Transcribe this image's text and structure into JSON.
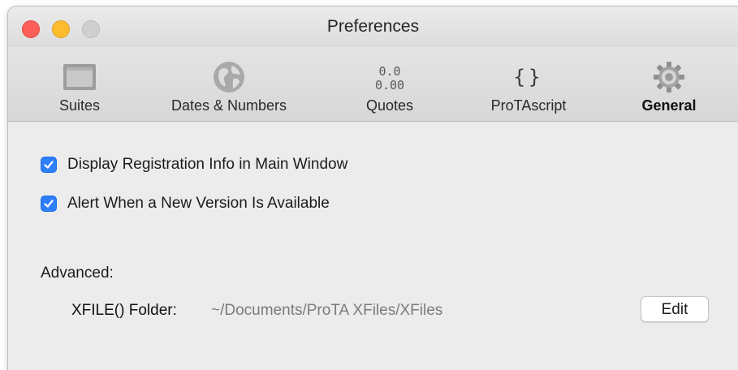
{
  "window": {
    "title": "Preferences"
  },
  "toolbar": {
    "items": [
      {
        "label": "Suites",
        "icon": "suites-icon"
      },
      {
        "label": "Dates & Numbers",
        "icon": "globe-icon"
      },
      {
        "label": "Quotes",
        "icon": "quotes-icon",
        "icon_text_1": "0.0",
        "icon_text_2": "0.00"
      },
      {
        "label": "ProTAscript",
        "icon": "braces-icon",
        "icon_text": "{}"
      },
      {
        "label": "General",
        "icon": "gear-icon",
        "selected": true
      }
    ]
  },
  "general": {
    "display_registration": {
      "label": "Display Registration Info in Main Window",
      "checked": true
    },
    "alert_new_version": {
      "label": "Alert When a New Version Is Available",
      "checked": true
    },
    "advanced_label": "Advanced:",
    "xfile_folder_label": "XFILE() Folder:",
    "xfile_folder_path": "~/Documents/ProTA XFiles/XFiles",
    "edit_label": "Edit"
  },
  "colors": {
    "accent": "#2d7ff9",
    "close": "#fc5f57",
    "minimize": "#fdbc2e",
    "zoom_disabled": "#cfcfcf"
  }
}
